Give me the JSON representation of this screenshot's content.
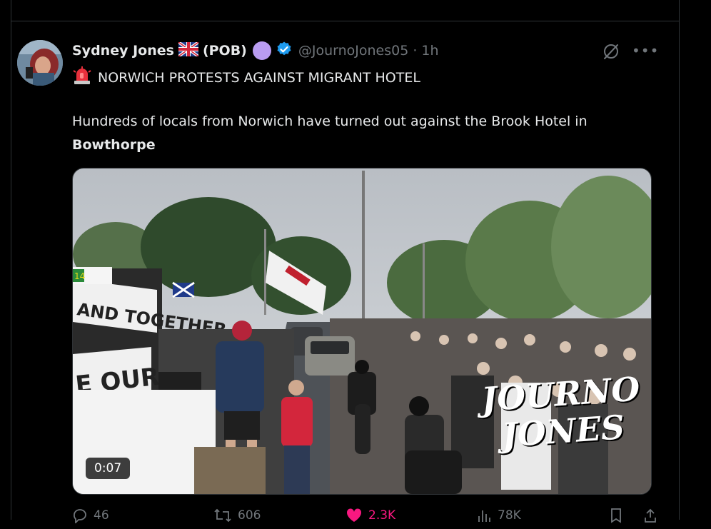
{
  "tweet": {
    "author_name": "Sydney Jones",
    "author_tag": "(POB)",
    "handle": "@JournoJones05",
    "separator": "·",
    "time": "1h",
    "headline": "NORWICH PROTESTS AGAINST MIGRANT HOTEL",
    "body_text": "Hundreds of locals from Norwich have turned out against the Brook Hotel in",
    "body_bold": "Bowthorpe",
    "more_label": "•••"
  },
  "media": {
    "duration": "0:07",
    "watermark_line1": "JOURNO",
    "watermark_line2": "JONES",
    "banner_text1": "AND TOGETHER",
    "banner_text2": "E OUR K",
    "sign_text": "14"
  },
  "actions": {
    "replies": "46",
    "reposts": "606",
    "likes": "2.3K",
    "views": "78K"
  },
  "colors": {
    "background": "#000000",
    "text": "#e7e9ea",
    "muted": "#71767b",
    "like": "#f91880",
    "verified": "#1d9bf0",
    "badge": "#b99cf1"
  }
}
